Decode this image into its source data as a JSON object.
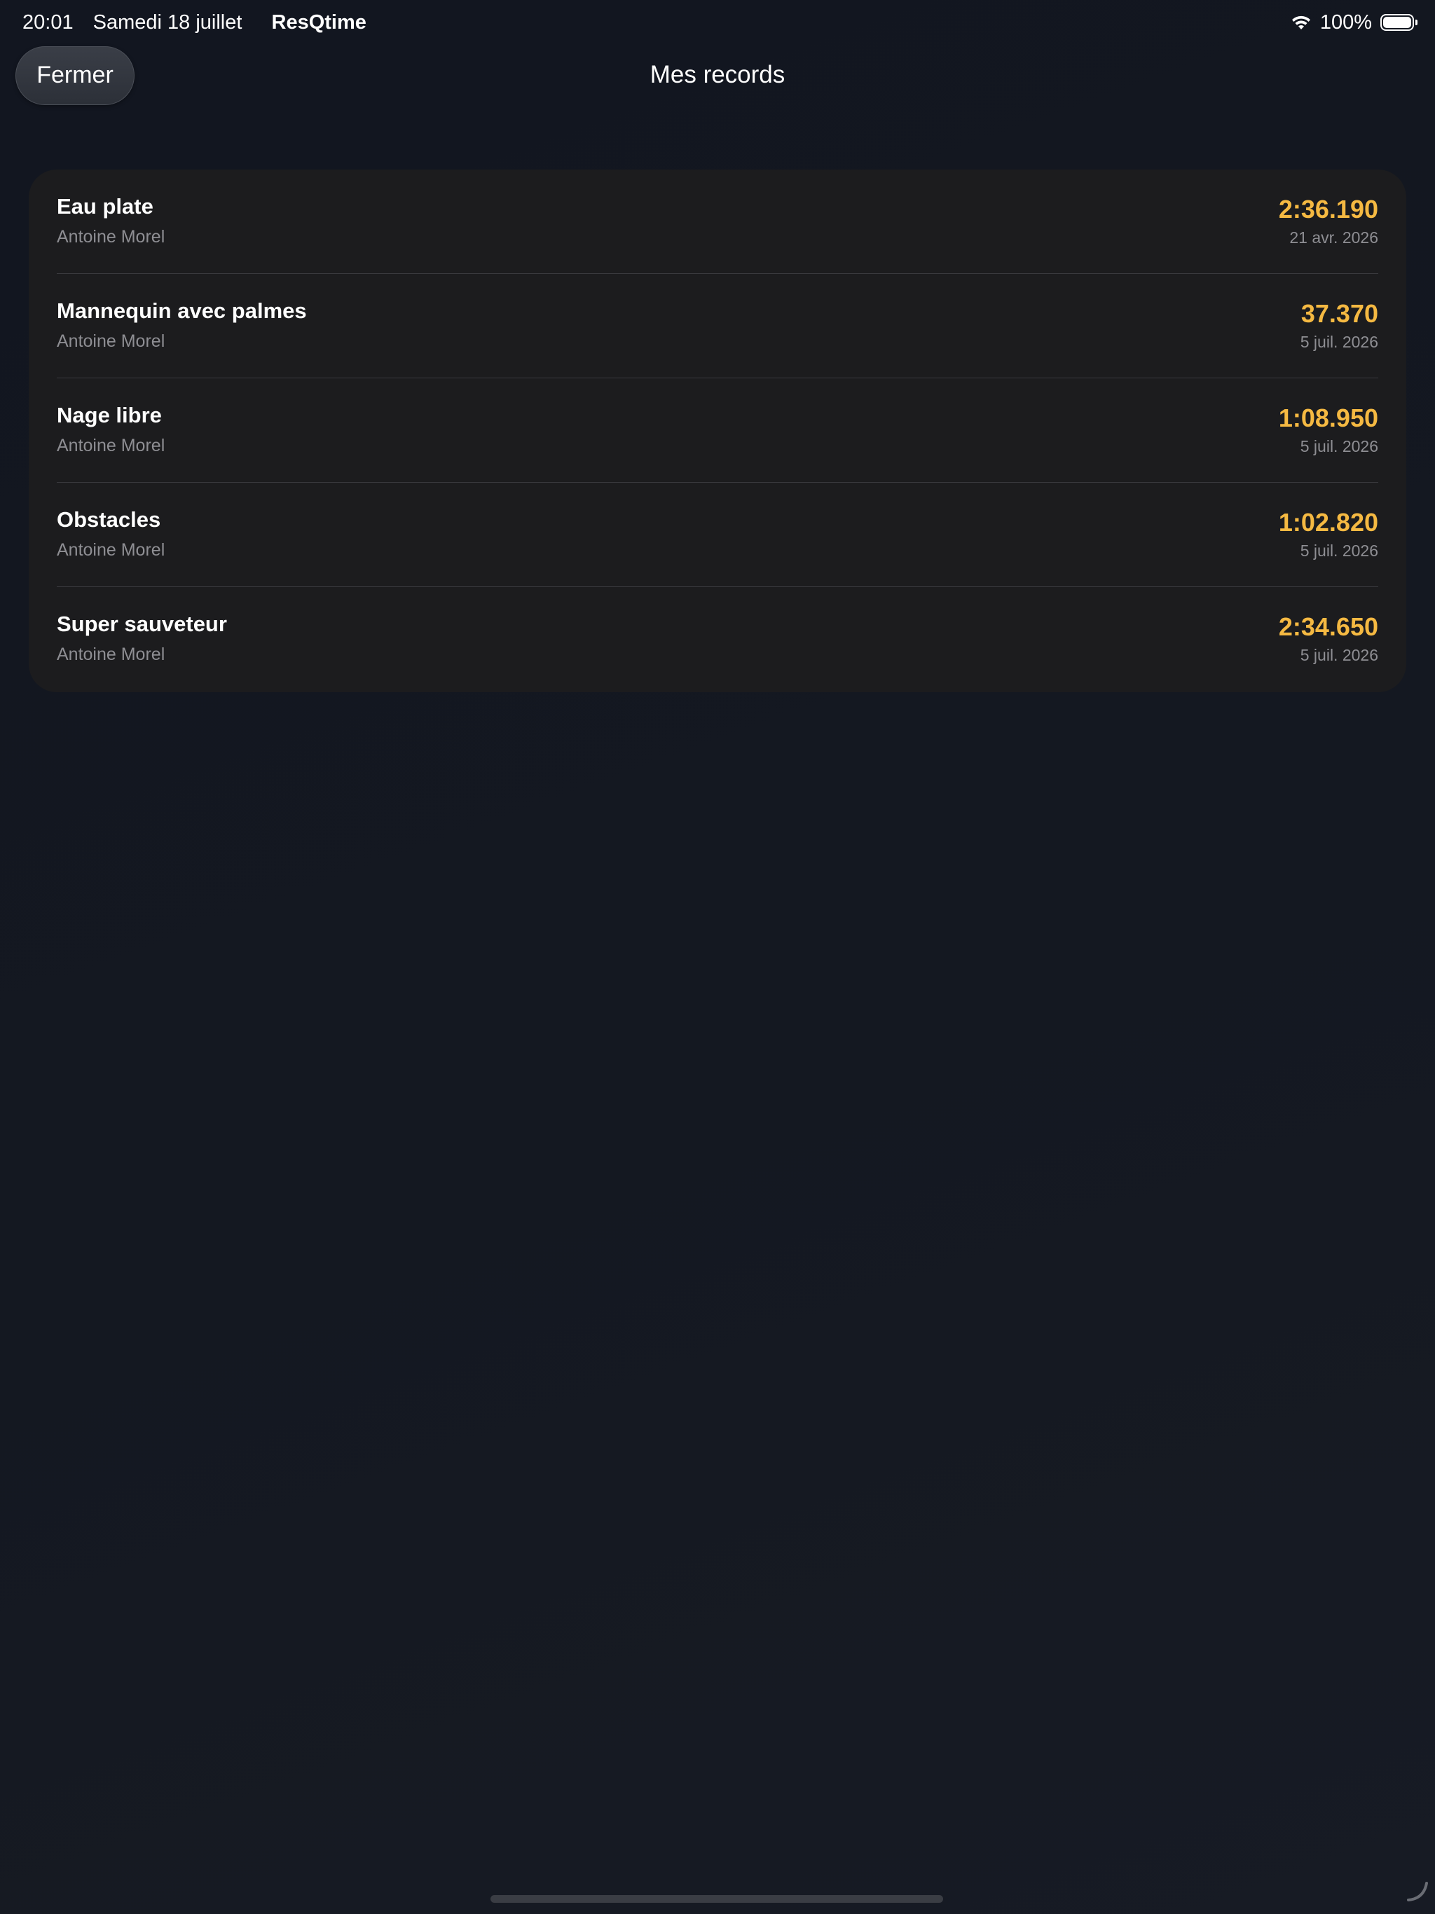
{
  "status_bar": {
    "time": "20:01",
    "date": "Samedi 18 juillet",
    "app_name": "ResQtime",
    "battery_percent": "100%",
    "battery_level": 1.0,
    "icons": [
      "wifi-icon",
      "battery-icon"
    ]
  },
  "nav": {
    "close_label": "Fermer",
    "title": "Mes records"
  },
  "colors": {
    "accent_time": "#f5b942",
    "background": "#131720",
    "card": "#1c1c1e",
    "secondary_text": "#8e8e93"
  },
  "records": [
    {
      "event": "Eau plate",
      "athlete": "Antoine Morel",
      "time": "2:36.190",
      "date": "21 avr. 2026"
    },
    {
      "event": "Mannequin avec palmes",
      "athlete": "Antoine Morel",
      "time": "37.370",
      "date": "5 juil. 2026"
    },
    {
      "event": "Nage libre",
      "athlete": "Antoine Morel",
      "time": "1:08.950",
      "date": "5 juil. 2026"
    },
    {
      "event": "Obstacles",
      "athlete": "Antoine Morel",
      "time": "1:02.820",
      "date": "5 juil. 2026"
    },
    {
      "event": "Super sauveteur",
      "athlete": "Antoine Morel",
      "time": "2:34.650",
      "date": "5 juil. 2026"
    }
  ]
}
